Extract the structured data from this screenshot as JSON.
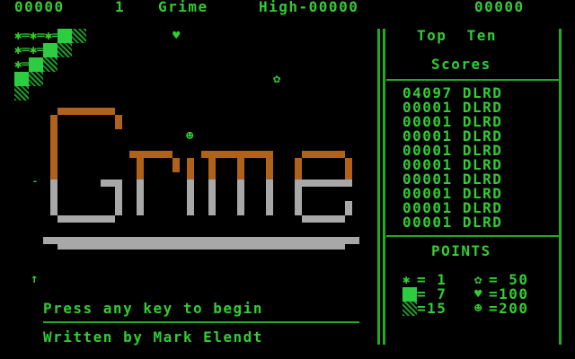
{
  "topbar": {
    "score": "00000",
    "level": "1",
    "title": "Grime",
    "high": "High-00000",
    "score2": "00000"
  },
  "top_ten": {
    "heading_line1": "Top  Ten",
    "heading_line2": "Scores",
    "entries": [
      {
        "score": "04097",
        "name": "DLRD"
      },
      {
        "score": "00001",
        "name": "DLRD"
      },
      {
        "score": "00001",
        "name": "DLRD"
      },
      {
        "score": "00001",
        "name": "DLRD"
      },
      {
        "score": "00001",
        "name": "DLRD"
      },
      {
        "score": "00001",
        "name": "DLRD"
      },
      {
        "score": "00001",
        "name": "DLRD"
      },
      {
        "score": "00001",
        "name": "DLRD"
      },
      {
        "score": "00001",
        "name": "DLRD"
      },
      {
        "score": "00001",
        "name": "DLRD"
      }
    ]
  },
  "points": {
    "heading": "POINTS",
    "rows": [
      {
        "left_icon": "grime-bug-icon",
        "left_value": "= 1",
        "right_icon": "flower-icon",
        "right_value": "= 50"
      },
      {
        "left_icon": "solid-block-icon",
        "left_value": "= 7",
        "right_icon": "heart-icon",
        "right_value": "=100"
      },
      {
        "left_icon": "dithered-block-icon",
        "left_value": "=15",
        "right_icon": "face-icon",
        "right_value": "=200"
      }
    ]
  },
  "messages": {
    "press_key": "Press any key to begin",
    "credit": "Written by Mark Elendt"
  },
  "logo_text": "Grime",
  "colors": {
    "green": "#33cc33",
    "brown": "#b0611a",
    "grey": "#a8a8a8",
    "background": "#000000"
  }
}
